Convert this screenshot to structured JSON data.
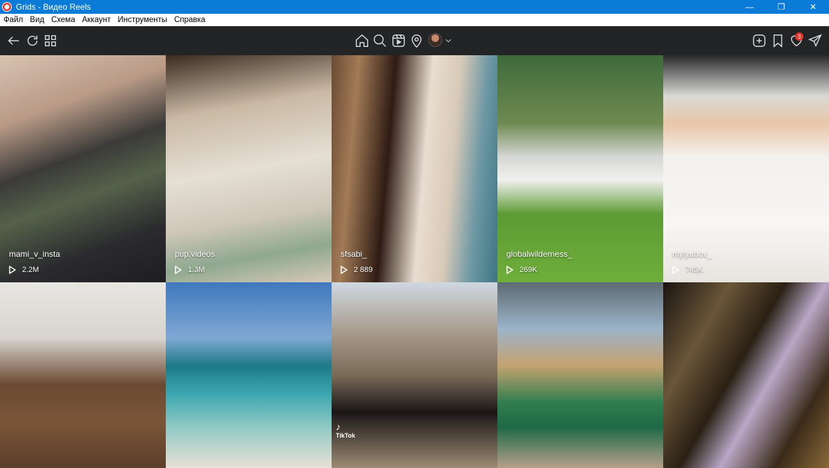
{
  "window": {
    "title": "Grids - Видео Reels",
    "controls": [
      "—",
      "❐",
      "✕"
    ]
  },
  "menu": [
    "Файл",
    "Вид",
    "Схема",
    "Аккаунт",
    "Инструменты",
    "Справка"
  ],
  "toolbar": {
    "notification_count": "3"
  },
  "tiles": [
    {
      "caption": "mami_v_insta",
      "views": "2.2M"
    },
    {
      "caption": "pup.videos",
      "views": "1.3M"
    },
    {
      "caption": "sfsabi_",
      "views": "2 889"
    },
    {
      "caption": "globalwilderness_",
      "views": "269K"
    },
    {
      "caption": "mylyubov_",
      "views": "745K"
    },
    {
      "caption": "",
      "views": ""
    },
    {
      "caption": "",
      "views": ""
    },
    {
      "caption": "",
      "views": ""
    },
    {
      "caption": "",
      "views": ""
    },
    {
      "caption": "",
      "views": ""
    }
  ],
  "overlays": {
    "tiktok_label": "TikTok"
  },
  "colors": {
    "titlebar": "#0a7bd6",
    "toolbar": "#222426",
    "badge": "#e5352b"
  }
}
